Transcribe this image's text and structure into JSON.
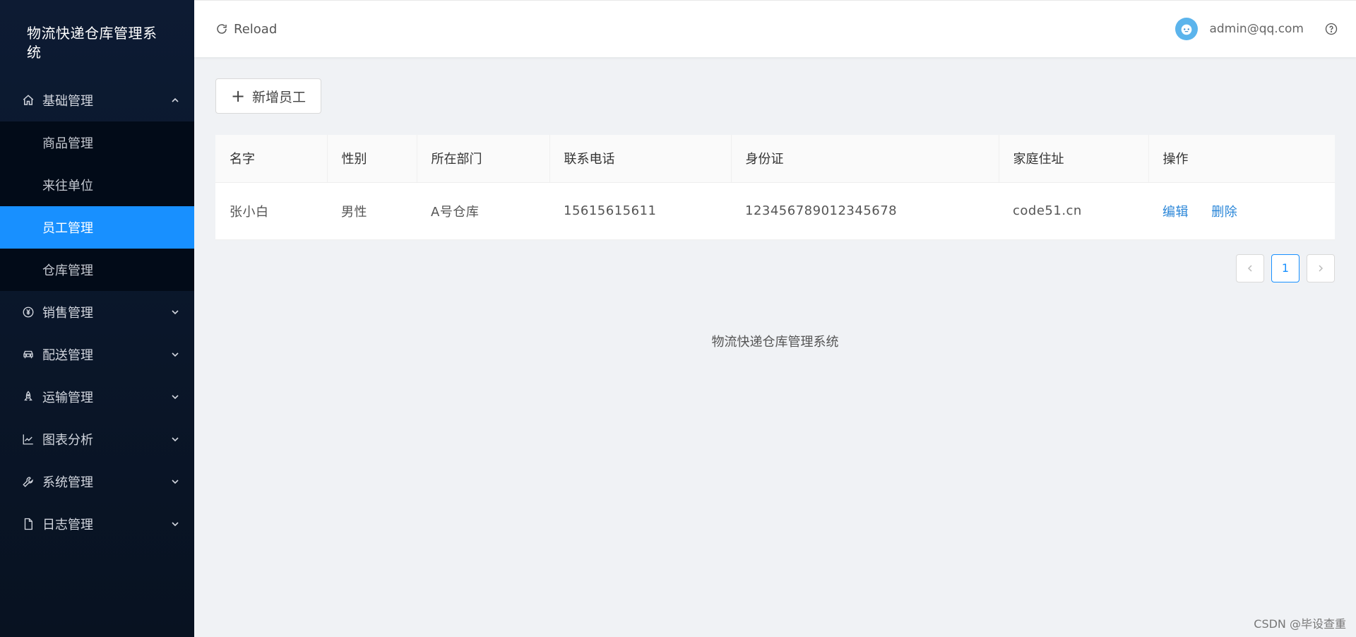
{
  "app": {
    "title": "物流快递仓库管理系统"
  },
  "sidebar": {
    "logo": "物流快递仓库管理系统",
    "menu": [
      {
        "label": "基础管理",
        "icon": "home-icon",
        "expanded": true,
        "children": [
          {
            "label": "商品管理",
            "active": false
          },
          {
            "label": "来往单位",
            "active": false
          },
          {
            "label": "员工管理",
            "active": true
          },
          {
            "label": "仓库管理",
            "active": false
          }
        ]
      },
      {
        "label": "销售管理",
        "icon": "yen-icon"
      },
      {
        "label": "配送管理",
        "icon": "car-icon"
      },
      {
        "label": "运输管理",
        "icon": "rocket-icon"
      },
      {
        "label": "图表分析",
        "icon": "line-chart-icon"
      },
      {
        "label": "系统管理",
        "icon": "wrench-icon"
      },
      {
        "label": "日志管理",
        "icon": "file-icon"
      }
    ]
  },
  "header": {
    "reload_label": "Reload",
    "user_email": "admin@qq.com"
  },
  "toolbar": {
    "add_label": "新增员工"
  },
  "table": {
    "columns": [
      "名字",
      "性别",
      "所在部门",
      "联系电话",
      "身份证",
      "家庭住址",
      "操作"
    ],
    "rows": [
      {
        "name": "张小白",
        "gender": "男性",
        "dept": "A号仓库",
        "phone": "15615615611",
        "id_card": "123456789012345678",
        "address": "code51.cn",
        "edit": "编辑",
        "delete": "删除"
      }
    ]
  },
  "pagination": {
    "current": "1"
  },
  "footer": {
    "text": "物流快递仓库管理系统"
  },
  "watermark": "CSDN @毕设查重",
  "colors": {
    "sidebar_bg": "#0d1b33",
    "accent": "#1890ff",
    "link": "#2a86d8",
    "page_bg": "#f0f2f5"
  }
}
